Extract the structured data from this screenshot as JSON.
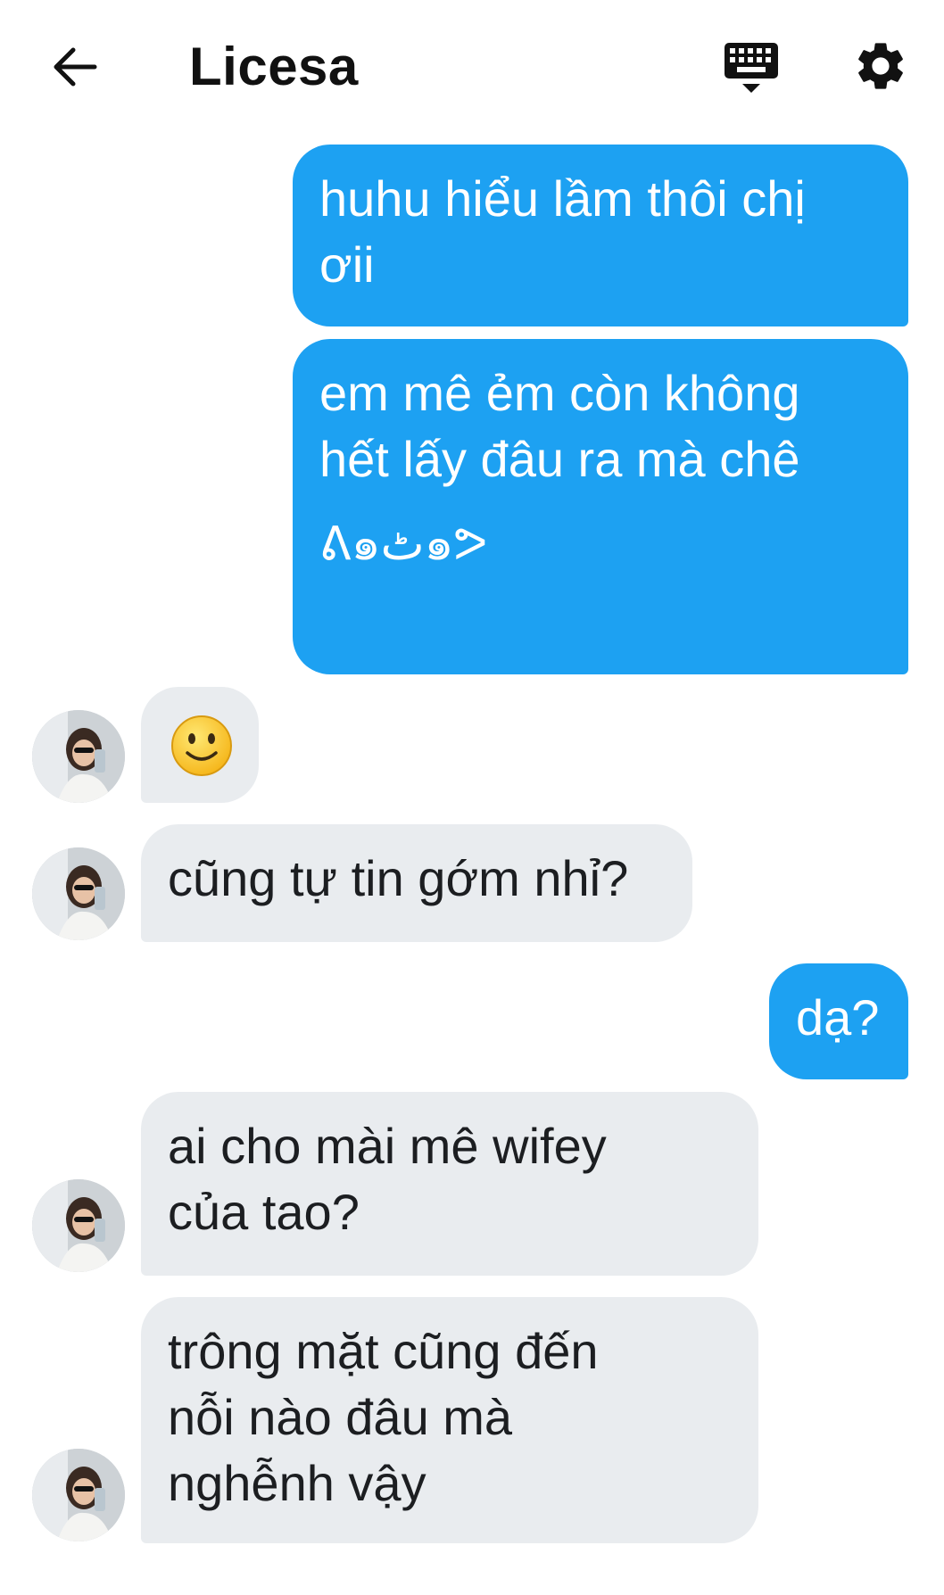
{
  "header": {
    "title": "Licesa",
    "back_icon": "arrow-left-icon",
    "keyboard_icon": "keyboard-icon",
    "settings_icon": "gear-icon"
  },
  "colors": {
    "outgoing_bubble": "#1da1f2",
    "incoming_bubble": "#e9ecef",
    "text_dark": "#1c1e21"
  },
  "messages": [
    {
      "direction": "out",
      "text": "huhu hiểu lầm thôi chị\nơii"
    },
    {
      "direction": "out",
      "text": "em mê ẻm còn không\nhết lấy đâu ra mà chê",
      "extra": "ᕕ๑ٹ๑ᕗ"
    },
    {
      "direction": "in",
      "emoji": "slightly-smiling-face-emoji"
    },
    {
      "direction": "in",
      "text": "cũng tự tin gớm nhỉ?"
    },
    {
      "direction": "out",
      "text": "dạ?"
    },
    {
      "direction": "in",
      "text": "ai cho mài mê wifey\ncủa tao?"
    },
    {
      "direction": "in",
      "text": "trông mặt cũng đến\nnỗi nào đâu mà\nnghễnh vậy"
    }
  ]
}
